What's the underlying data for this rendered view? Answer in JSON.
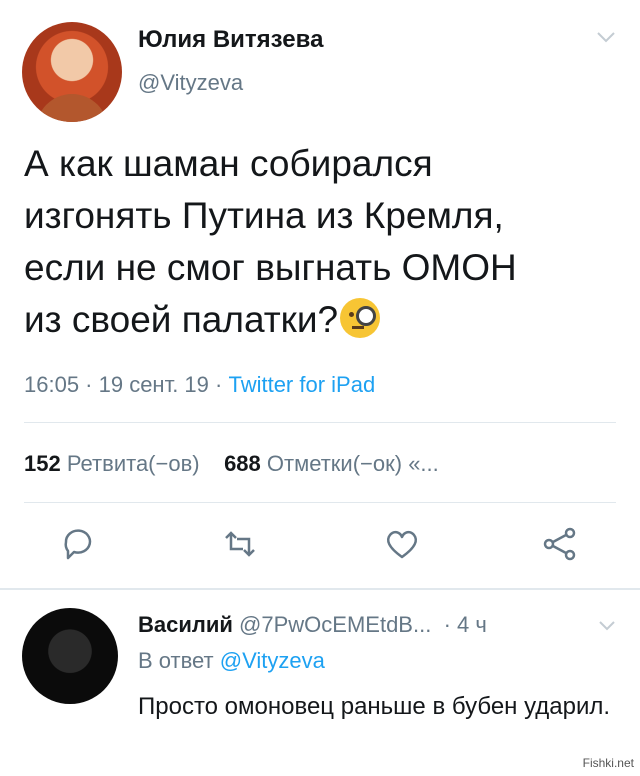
{
  "tweet": {
    "author_name": "Юлия Витязева",
    "author_handle": "@Vityzeva",
    "text_lines": [
      "А как шаман собирался",
      "изгонять Путина из Кремля,",
      "если не смог выгнать ОМОН",
      "из своей палатки?"
    ],
    "emoji": "face-with-monocle",
    "meta_time": "16:05 · 19 сент. 19 · ",
    "meta_source": "Twitter for iPad",
    "retweets_count": "152",
    "retweets_label": "Ретвита(−ов)",
    "likes_count": "688",
    "likes_label": "Отметки(−ок) «..."
  },
  "actions": [
    "reply-icon",
    "retweet-icon",
    "like-icon",
    "share-icon"
  ],
  "reply": {
    "author_name": "Василий",
    "author_handle": "@7PwOcEMEtdB...",
    "time": "· 4 ч",
    "in_reply_prefix": "В ответ ",
    "in_reply_mention": "@Vityzeva",
    "text": "Просто омоновец раньше в бубен ударил."
  },
  "watermark": "Fishki.net",
  "colors": {
    "text": "#14171a",
    "secondary": "#657786",
    "link": "#1da1f2",
    "divider": "#e1e8ed"
  }
}
